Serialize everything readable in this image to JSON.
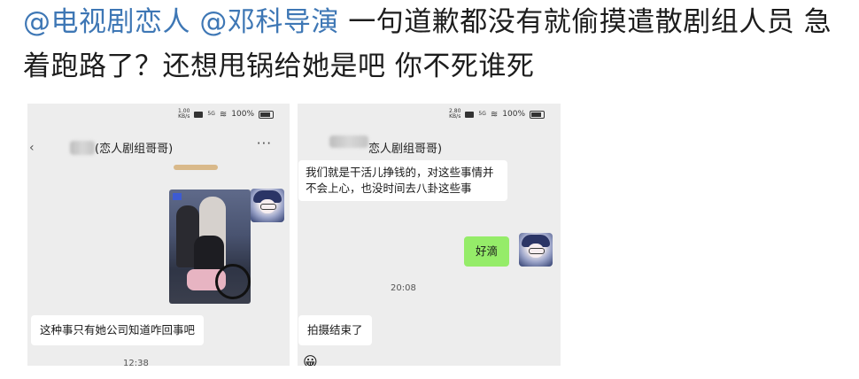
{
  "post": {
    "mention1": "@电视剧恋人",
    "mention2": "@邓科导演",
    "text": " 一句道歉都没有就偷摸遣散剧组人员 急着跑路了？还想甩锅给她是吧 你不死谁死"
  },
  "left_screenshot": {
    "status": {
      "net_speed_top": "1.00",
      "net_speed_bottom": "KB/s",
      "network": "5G",
      "battery": "100%"
    },
    "chat_title": "(恋人剧组哥哥)",
    "more_icon": "···",
    "message_incoming": "这种事只有她公司知道咋回事吧",
    "timestamp_partial": "12:38"
  },
  "right_screenshot": {
    "status": {
      "net_speed_top": "2.80",
      "net_speed_bottom": "KB/s",
      "network": "5G",
      "battery": "100%"
    },
    "chat_title": "恋人剧组哥哥)",
    "message_incoming_1": "我们就是干活儿挣钱的，对这些事情并不会上心，也没时间去八卦这些事",
    "message_outgoing": "好滴",
    "timestamp": "20:08",
    "message_incoming_2": "拍摄结束了"
  },
  "colors": {
    "mention": "#3e77b5",
    "chat_background": "#ededed",
    "outgoing_bubble": "#95ec69",
    "incoming_bubble": "#ffffff"
  }
}
